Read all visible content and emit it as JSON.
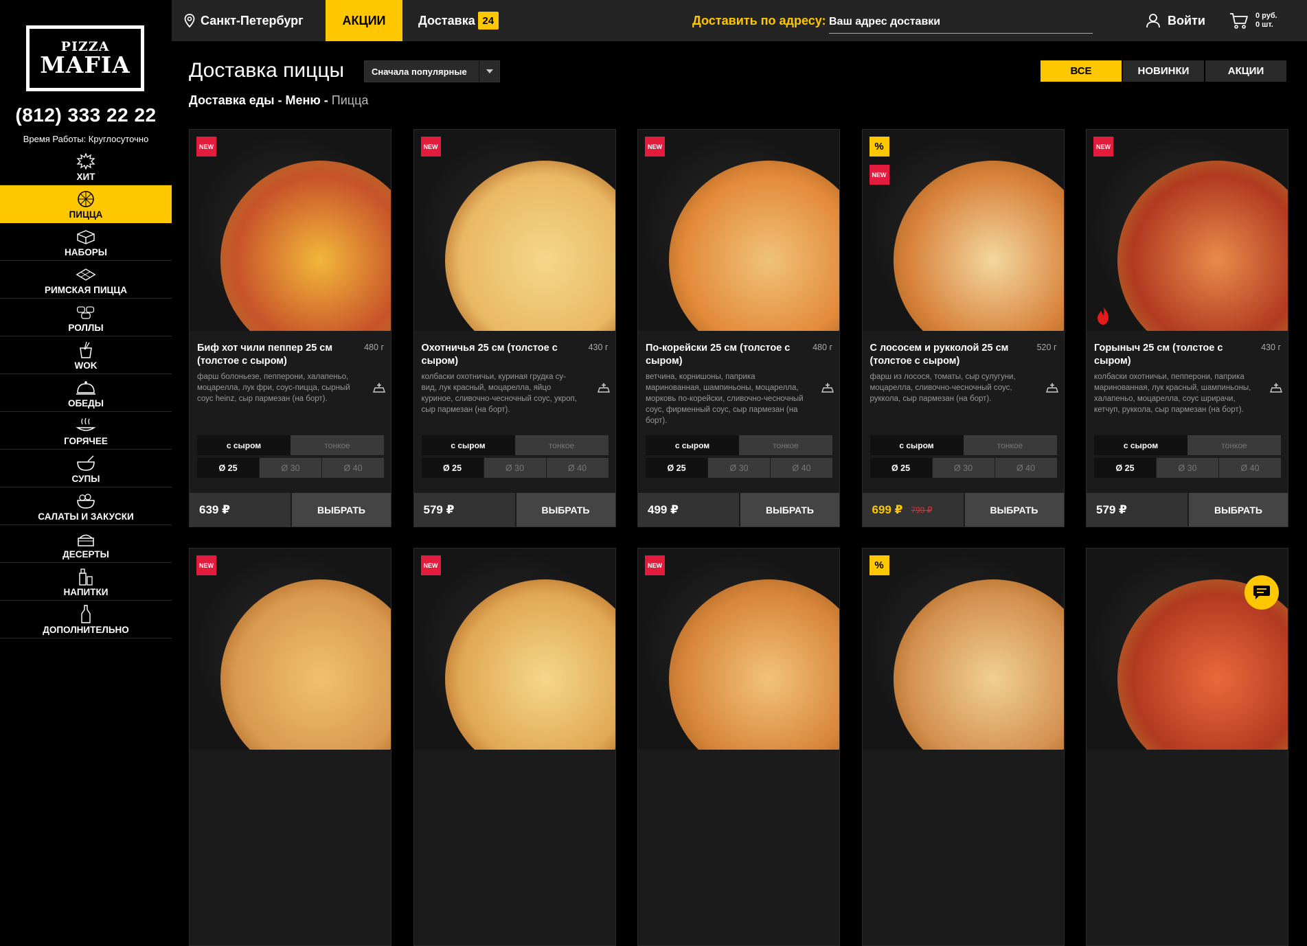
{
  "brand": {
    "line1": "PIZZA",
    "line2": "MAFIA"
  },
  "sidebar": {
    "phone": "(812) 333 22 22",
    "hours": "Время Работы: Круглосуточно",
    "items": [
      {
        "label": "ХИТ",
        "icon": "hit-badge-icon"
      },
      {
        "label": "ПИЦЦА",
        "icon": "pizza-icon"
      },
      {
        "label": "НАБОРЫ",
        "icon": "combo-box-icon"
      },
      {
        "label": "РИМСКАЯ ПИЦЦА",
        "icon": "roman-pizza-icon"
      },
      {
        "label": "РОЛЛЫ",
        "icon": "rolls-icon"
      },
      {
        "label": "WOK",
        "icon": "wok-icon"
      },
      {
        "label": "ОБЕДЫ",
        "icon": "cloche-icon"
      },
      {
        "label": "ГОРЯЧЕЕ",
        "icon": "hot-dish-icon"
      },
      {
        "label": "СУПЫ",
        "icon": "soup-icon"
      },
      {
        "label": "САЛАТЫ И ЗАКУСКИ",
        "icon": "salad-icon"
      },
      {
        "label": "ДЕСЕРТЫ",
        "icon": "cake-icon"
      },
      {
        "label": "НАПИТКИ",
        "icon": "drinks-icon"
      },
      {
        "label": "ДОПОЛНИТЕЛЬНО",
        "icon": "sauce-bottle-icon"
      }
    ]
  },
  "topbar": {
    "city": "Санкт-Петербург",
    "promo": "АКЦИИ",
    "delivery": "Доставка",
    "delivery_count": "24",
    "address_label": "Доставить по адресу:",
    "address_placeholder": "Ваш адрес доставки",
    "login": "Войти",
    "cart_sum": "0 руб.",
    "cart_count": "0 шт."
  },
  "main": {
    "title": "Доставка пиццы",
    "sort": "Сначала популярные",
    "filters": [
      "ВСЕ",
      "НОВИНКИ",
      "АКЦИИ"
    ],
    "breadcrumb": {
      "part1": "Доставка еды",
      "sep": " - ",
      "part2": "Меню",
      "current": "Пицца"
    }
  },
  "card_labels": {
    "new_badge": "NEW",
    "promo_badge": "%",
    "dough_cheese": "с сыром",
    "dough_thin": "тонкое",
    "size_25": "Ø 25",
    "size_30": "Ø 30",
    "size_40": "Ø 40",
    "select": "ВЫБРАТЬ"
  },
  "products": [
    {
      "name": "Биф хот чили пеппер 25 см (толстое с сыром)",
      "weight": "480 г",
      "desc": "фарш болоньезе, пепперони, халапеньо, моцарелла, лук фри, соус-пицца, сырный соус heinz, сыр пармезан (на борт).",
      "price": "639 ₽",
      "old_price": "",
      "badges": [
        "new"
      ],
      "fire": false
    },
    {
      "name": "Охотничья 25 см (толстое с сыром)",
      "weight": "430 г",
      "desc": "колбаски охотничьи, куриная грудка су-вид, лук красный, моцарелла, яйцо куриное, сливочно-чесночный соус, укроп, сыр пармезан (на борт).",
      "price": "579 ₽",
      "old_price": "",
      "badges": [
        "new"
      ],
      "fire": false
    },
    {
      "name": "По-корейски 25 см (толстое с сыром)",
      "weight": "480 г",
      "desc": "ветчина, корнишоны, паприка маринованная, шампиньоны, моцарелла, морковь по-корейски, сливочно-чесночный соус, фирменный соус, сыр пармезан (на борт).",
      "price": "499 ₽",
      "old_price": "",
      "badges": [
        "new"
      ],
      "fire": false
    },
    {
      "name": "С лососем и рукколой 25 см (толстое с сыром)",
      "weight": "520 г",
      "desc": "фарш из лосося, томаты, сыр сулугуни, моцарелла, сливочно-чесночный соус, руккола, сыр пармезан (на борт).",
      "price": "699 ₽",
      "old_price": "799 ₽",
      "badges": [
        "promo",
        "new"
      ],
      "fire": false
    },
    {
      "name": "Горыныч 25 см (толстое с сыром)",
      "weight": "430 г",
      "desc": "колбаски охотничьи, пепперони, паприка маринованная, лук красный, шампиньоны, халапеньо, моцарелла, соус шрирачи, кетчуп, руккола, сыр пармезан (на борт).",
      "price": "579 ₽",
      "old_price": "",
      "badges": [
        "new"
      ],
      "fire": true
    },
    {
      "badges": [
        "new"
      ]
    },
    {
      "badges": [
        "new"
      ]
    },
    {
      "badges": [
        "new"
      ]
    },
    {
      "badges": [
        "promo"
      ]
    },
    {
      "badges": []
    }
  ],
  "colors": {
    "accent": "#ffc700",
    "new_badge": "#e31b3c",
    "topbar": "#242424",
    "card": "#1b1b1b"
  }
}
